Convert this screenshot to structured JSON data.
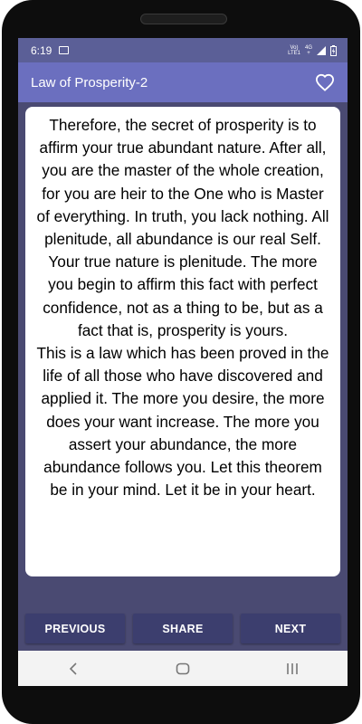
{
  "status_bar": {
    "time": "6:19",
    "network_top": "Vo)",
    "network_bottom": "LTE1",
    "signal_top": "4G",
    "signal_bottom": "+"
  },
  "app_bar": {
    "title": "Law of Prosperity-2",
    "favorite_icon": "heart-outline-icon"
  },
  "content": {
    "paragraphs": [
      "Therefore, the secret of prosperity is to affirm your true abundant nature. After all, you are the master of the whole creation, for you are heir to the One who is Master of everything. In truth, you lack nothing. All plenitude, all abundance is our real Self. Your true nature is plenitude. The more you begin to affirm this fact with perfect confidence, not as a thing to be, but as a fact that is, prosperity is yours.",
      "This is a law which has been proved in the life of all those who have discovered and applied it. The more you desire, the more does your want increase. The more you assert your abundance, the more abundance follows you. Let this theorem be in your mind. Let it be in your heart."
    ]
  },
  "buttons": {
    "previous": "PREVIOUS",
    "share": "SHARE",
    "next": "NEXT"
  },
  "nav_bar": {
    "back": "back-icon",
    "home": "home-icon",
    "recents": "recents-icon"
  },
  "colors": {
    "status_bar": "#5b5f97",
    "app_bar": "#6b6fbf",
    "background": "#4a4a72",
    "button": "#3c3e6e"
  }
}
